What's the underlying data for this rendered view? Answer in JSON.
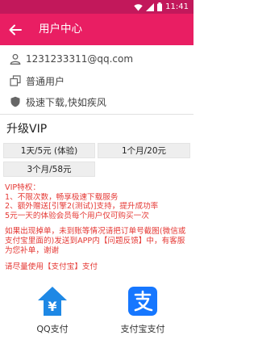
{
  "status_bar": {
    "time": "11:41",
    "icons": [
      "wifi-icon",
      "signal-icon",
      "battery-icon"
    ]
  },
  "app_bar": {
    "title": "用户中心"
  },
  "user": {
    "email": "1231233311@qq.com",
    "level": "普通用户",
    "slogan": "极速下载,快如疾风"
  },
  "upgrade": {
    "title": "升级VIP",
    "plans": [
      "1天/5元 (体验)",
      "1个月/20元",
      "3个月/58元"
    ]
  },
  "notes": {
    "heading": "VIP特权：",
    "line1": "1、不限次数，畅享极速下载服务",
    "line2": "2、额外赠送[引擎2(测试)]支持，提升成功率",
    "line3": "5元一天的体验会员每个用户仅可购买一次",
    "para": "如果出现掉单，未到账等情况请把订单号截图(微信或支付宝里面的)发送到APP内【问题反馈】中，有客服为您补单，谢谢",
    "tail": "请尽量使用【支付宝】支付"
  },
  "payment": {
    "qq": "QQ支付",
    "alipay": "支付宝支付"
  },
  "colors": {
    "primary": "#e91e63",
    "status": "#c2185b",
    "note": "#e53935",
    "qq": "#1e88e5",
    "alipay": "#1677ff"
  }
}
